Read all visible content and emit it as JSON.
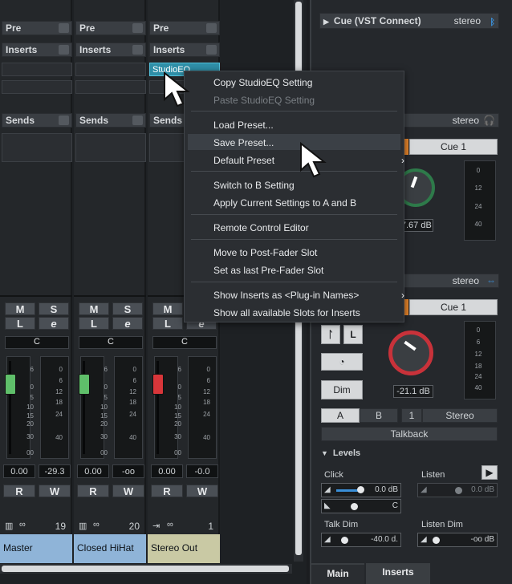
{
  "mixer": {
    "channels": [
      {
        "name": "Master",
        "number": "19",
        "pan": "C",
        "fader_value": "0.00",
        "peak_value": "-29.3",
        "pre_label": "Pre",
        "inserts_label": "Inserts",
        "sends_label": "Sends",
        "mute": "M",
        "solo": "S",
        "listen": "L",
        "edit": "e",
        "read": "R",
        "write": "W",
        "color": "#8fb4d8"
      },
      {
        "name": "Closed HiHat",
        "number": "20",
        "pan": "C",
        "fader_value": "0.00",
        "peak_value": "-oo",
        "pre_label": "Pre",
        "inserts_label": "Inserts",
        "sends_label": "Sends",
        "mute": "M",
        "solo": "S",
        "listen": "L",
        "edit": "e",
        "read": "R",
        "write": "W",
        "color": "#8fb4d8"
      },
      {
        "name": "Stereo Out",
        "number": "1",
        "pan": "C",
        "fader_value": "0.00",
        "peak_value": "-0.0",
        "pre_label": "Pre",
        "inserts_label": "Inserts",
        "sends_label": "Sends",
        "mute": "M",
        "solo": "S",
        "listen": "L",
        "edit": "e",
        "read": "R",
        "write": "W",
        "color": "#c9c9a4",
        "insert_slot": "StudioEQ"
      }
    ],
    "scale_left": [
      "6",
      "0",
      "5",
      "10",
      "15",
      "20",
      "30",
      "00"
    ],
    "scale_right": [
      "0",
      "6",
      "12",
      "18",
      "24",
      "40"
    ]
  },
  "context_menu": {
    "items": [
      {
        "label": "Copy StudioEQ Setting",
        "disabled": false
      },
      {
        "label": "Paste StudioEQ Setting",
        "disabled": true
      },
      {
        "label": "Load Preset...",
        "disabled": false
      },
      {
        "label": "Save Preset...",
        "disabled": false,
        "highlighted": true
      },
      {
        "label": "Default Preset",
        "disabled": false,
        "submenu": true
      },
      {
        "label": "Switch to B Setting",
        "disabled": false
      },
      {
        "label": "Apply Current Settings to A and B",
        "disabled": false
      },
      {
        "label": "Remote Control Editor",
        "disabled": false
      },
      {
        "label": "Move to Post-Fader Slot",
        "disabled": false
      },
      {
        "label": "Set as last Pre-Fader Slot",
        "disabled": false
      },
      {
        "label": "Show Inserts as <Plug-in Names>",
        "disabled": false,
        "submenu": true
      },
      {
        "label": "Show all available Slots for Inserts",
        "disabled": false
      }
    ]
  },
  "control_room": {
    "cue_header": "Cue (VST Connect)",
    "cue_header_format": "stereo",
    "strip1": {
      "format": "stereo",
      "cue_label": "Cue 1",
      "gain": "-7.67 dB",
      "scale": [
        "0",
        "12",
        "24",
        "40"
      ]
    },
    "strip2": {
      "format": "stereo",
      "cue_label": "Cue 1",
      "gain": "-21.1 dB",
      "scale": [
        "0",
        "6",
        "12",
        "18",
        "24",
        "40"
      ]
    },
    "dim_label": "Dim",
    "ab_buttons": [
      "A",
      "B",
      "1",
      "Stereo"
    ],
    "talkback_label": "Talkback",
    "levels_header": "Levels",
    "click_label": "Click",
    "click_value": "0.0 dB",
    "click_pan": "C",
    "listen_label": "Listen",
    "listen_value": "0.0 dB",
    "talkdim_label": "Talk Dim",
    "talkdim_value": "-40.0 d.",
    "listendim_label": "Listen Dim",
    "listendim_value": "-oo dB",
    "tabs": [
      "Main",
      "Inserts"
    ]
  },
  "colors": {
    "accent_orange": "#e8862b",
    "accent_blue": "#3a8fd8",
    "fader_green": "#5fbf6a",
    "fader_red": "#d8363a"
  }
}
